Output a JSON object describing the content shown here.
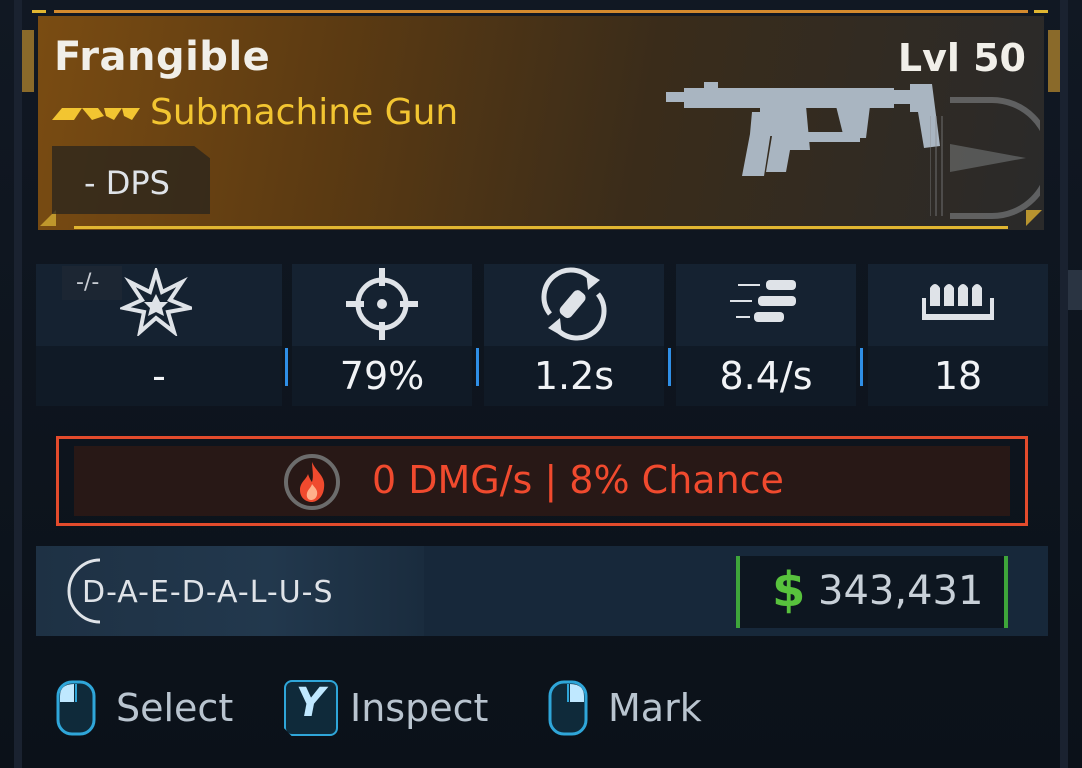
{
  "item": {
    "name": "Frangible",
    "level": "Lvl 50",
    "type": "Submachine Gun",
    "dps": "- DPS",
    "rarity_icon": "rarity-chevrons-icon",
    "weapon_icon": "submachine-gun-icon"
  },
  "stats": [
    {
      "id": "damage",
      "icon": "burst-icon",
      "value": "-"
    },
    {
      "id": "accuracy",
      "icon": "crosshair-icon",
      "value": "79%"
    },
    {
      "id": "reload",
      "icon": "reload-icon",
      "value": "1.2s"
    },
    {
      "id": "fire-rate",
      "icon": "bullets-icon",
      "value": "8.4/s"
    },
    {
      "id": "magazine",
      "icon": "magazine-icon",
      "value": "18"
    }
  ],
  "element_badge": "-/-",
  "elemental": {
    "icon": "fire-icon",
    "text": "0 DMG/s | 8% Chance",
    "color": "#f04a2e"
  },
  "manufacturer": {
    "name": "D-A-E-D-A-L-U-S",
    "logo_icon": "daedalus-logo-icon"
  },
  "money": {
    "symbol": "$",
    "value": "343,431",
    "color": "#58c23d"
  },
  "prompts": [
    {
      "icon": "mouse-left-icon",
      "label": "Select"
    },
    {
      "icon": "y-button-icon",
      "key": "Y",
      "label": "Inspect"
    },
    {
      "icon": "mouse-right-icon",
      "label": "Mark"
    }
  ],
  "colors": {
    "accent_gold": "#e1b631",
    "rarity_yellow": "#f2c531",
    "stat_divider": "#2f8fe6",
    "fire_red": "#e34b2c"
  }
}
